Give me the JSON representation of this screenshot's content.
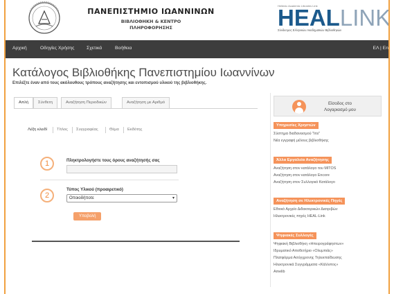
{
  "header": {
    "university_name": "ΠΑΝΕΠΙΣΤΗΜΙΟ ΙΩΑΝΝΙΝΩΝ",
    "university_sub_1": "ΒΙΒΛΙΟΘΗΚΗ & ΚΕΝΤΡΟ",
    "university_sub_2": "ΠΛΗΡΟΦΟΡΗΣΗΣ",
    "heal_tagline": "Hellenic Academic Libraries Link",
    "heal_logo_bold": "HEAL",
    "heal_logo_light": "LINK",
    "heal_caption": "Σύνδεσμος Ελληνικών Ακαδημαϊκών Βιβλιοθηκών"
  },
  "nav": {
    "items": [
      "Αρχική",
      "Οδηγίες Χρήσης",
      "Σχετικά",
      "Βοήθεια"
    ],
    "lang": "ΕΛ | En"
  },
  "page": {
    "title": "Κατάλογος Βιβλιοθήκης Πανεπιστημίου Ιωαννίνων",
    "subtitle": "Επιλέξτε έναν από τους ακόλουθους τρόπους αναζήτησης και εντοπισμού υλικού της βιβλιοθήκης."
  },
  "search": {
    "tabs": [
      "Απλή",
      "Σύνθετη",
      "Αναζήτηση Περιοδικών",
      "Αναζήτηση με Αριθμό"
    ],
    "active_tab": "Απλή",
    "subtabs": [
      "Λέξη κλειδί",
      "Τίτλος",
      "Συγγραφέας",
      "Θέμα",
      "Εκδότης"
    ],
    "step1_number": "1",
    "step1_label": "Πληκτρολογήστε τους όρους αναζήτησής σας",
    "step1_value": "",
    "step2_number": "2",
    "step2_label": "Τύπος Υλικού (προαιρετικό)",
    "step2_selected": "Οποιοδήποτε",
    "submit_label": "Υποβολή"
  },
  "sidebar": {
    "login_line1": "Είσοδος στο",
    "login_line2": "Λογαριασμό μου",
    "sections": [
      {
        "title": "Υπηρεσίες Χρηστών",
        "links": [
          "Σύστημα διαδανεισμού \"Iris\"",
          "Νέα εγγραφή μέλους βιβλιοθήκης"
        ]
      },
      {
        "title": "Άλλα Εργαλεία Αναζήτησης",
        "links": [
          "Αναζήτηση στον κατάλογο του MITOS",
          "Αναζήτηση στον κατάλογο Encore",
          "Αναζήτηση στον Συλλογικό Κατάλογο"
        ]
      },
      {
        "title": "Αναζήτηση σε Ηλεκτρονικές Πηγές",
        "links": [
          "Εθνικό Αρχείο Διδακτορικών Διατριβών",
          "Ηλεκτρονικές πηγές HEAL-Link"
        ]
      },
      {
        "title": "Ψηφιακές Συλλογές",
        "links": [
          "Ψηφιακή Βιβλιοθήκη «Ηπειρογράφηστων»",
          "Ιδρυματικό Αποθετήριο «Ολυμπιάς»",
          "Πλατφόρμα Ασύγχρονης Τηλεκπαίδευσης",
          "Ηλεκτρονικά Συγγράμματα «Κάλλιπος»",
          "Amelib"
        ]
      }
    ]
  },
  "colors": {
    "accent_orange": "#f5935a",
    "nav_bg": "#3d3d3d",
    "heal_blue": "#1c5a8c",
    "frame_border": "#f0a040"
  },
  "icons": {
    "university_seal": "university-seal-icon",
    "login": "user-avatar-icon",
    "select": "chevron-down-icon"
  }
}
